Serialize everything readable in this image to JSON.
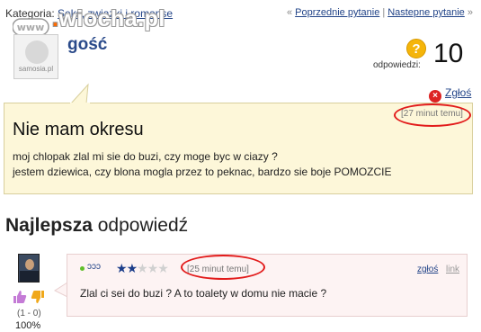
{
  "topbar": {
    "category_prefix": "Kategoria:",
    "category_link": "Seks, zwiazki i romanse",
    "prev_label": "Poprzednie pytanie",
    "next_label": "Nastepne pytanie",
    "left_arrow": "«",
    "right_arrow": "»",
    "separator": "|"
  },
  "watermark": {
    "prefix": "www",
    "dot": ".",
    "name": "wiocha",
    "suffix": ".pl"
  },
  "asker": {
    "avatar_logo_text": "samosia.pl",
    "name": "gość"
  },
  "answers": {
    "icon_symbol": "?",
    "label": "odpowiedzi:",
    "count": "10"
  },
  "report": {
    "icon_symbol": "×",
    "label": "Zgłoś"
  },
  "question": {
    "time": "[27 minut temu]",
    "title": "Nie mam okresu",
    "line1": "moj chlopak zlal mi sie do buzi, czy moge byc w ciazy ?",
    "line2": "jestem dziewica, czy blona mogla przez to peknac, bardzo sie boje POMOZCIE"
  },
  "best": {
    "heading_bold": "Najlepsza",
    "heading_rest": " odpowiedź"
  },
  "answer": {
    "user_name": "ᴐᴐᴐ",
    "rating": 2,
    "rating_max": 5,
    "time": "[25 minut temu]",
    "report_label": "zgłoś",
    "link_label": "link",
    "text": "Zlal ci sei do buzi ? A to toalety w domu nie macie ?"
  },
  "votes": {
    "count": "(1 - 0)",
    "percent": "100%"
  },
  "colors": {
    "link": "#224488",
    "question_bg": "#fdf7d9",
    "answer_bg": "#fdf3f3",
    "highlight_oval": "#e21b1b",
    "star_on": "#1c3e8a"
  }
}
